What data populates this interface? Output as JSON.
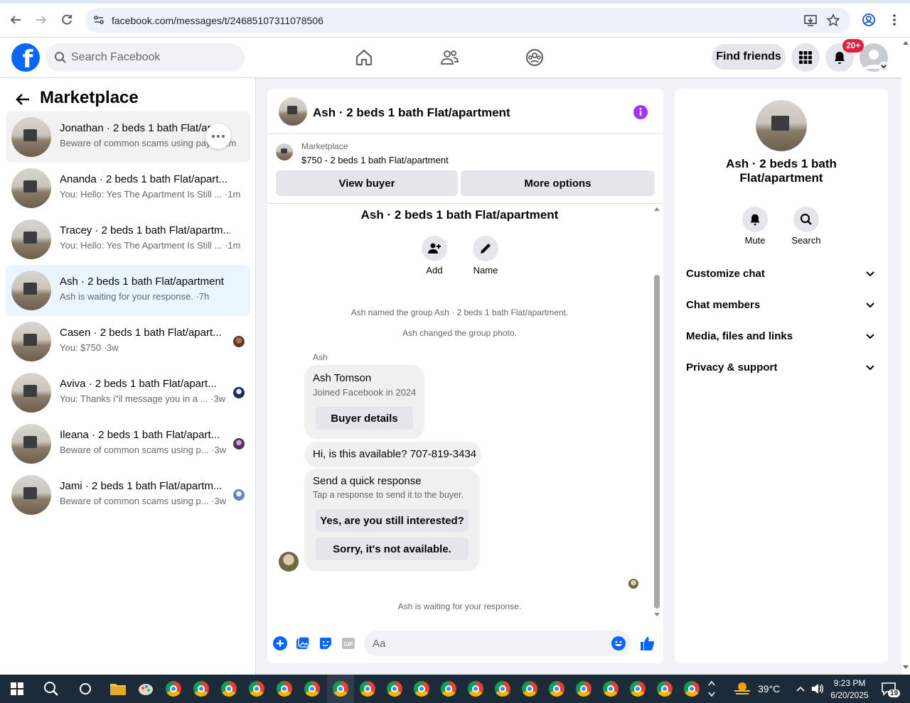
{
  "browser": {
    "url": "facebook.com/messages/t/24685107311078506"
  },
  "header": {
    "search_placeholder": "Search Facebook",
    "find_friends": "Find friends",
    "notifications_badge": "20+"
  },
  "sidebar": {
    "title": "Marketplace",
    "conversations": [
      {
        "title": "Jonathan · 2 beds 1 bath Flat/ap...",
        "subtitle": "Beware of common scams using pay... ·1m",
        "state": "hover"
      },
      {
        "title": "Ananda · 2 beds 1 bath Flat/apart...",
        "subtitle": "You: Hello: Yes The Apartment Is Still ... ·1m",
        "state": "normal"
      },
      {
        "title": "Tracey · 2 beds 1 bath Flat/apartm...",
        "subtitle": "You: Hello: Yes The Apartment Is Still ... ·1m",
        "state": "normal"
      },
      {
        "title": "Ash · 2 beds 1 bath Flat/apartment",
        "subtitle": "Ash is waiting for your response. ·7h",
        "state": "active"
      },
      {
        "title": "Casen · 2 beds 1 bath Flat/apart...",
        "subtitle": "You: $750 ·3w",
        "state": "normal"
      },
      {
        "title": "Aviva · 2 beds 1 bath Flat/apart...",
        "subtitle": "You: Thanks i\"il message you in a ... ·3w",
        "state": "normal"
      },
      {
        "title": "Ileana · 2 beds 1 bath Flat/apart...",
        "subtitle": "Beware of common scams using p... ·3w",
        "state": "normal"
      },
      {
        "title": "Jami · 2 beds 1 bath Flat/apartm...",
        "subtitle": "Beware of common scams using p... ·3w",
        "state": "normal"
      }
    ]
  },
  "chat": {
    "title": "Ash · 2 beds 1 bath Flat/apartment",
    "listing_source": "Marketplace",
    "listing_price_title": "$750 - 2 beds 1 bath Flat/apartment",
    "view_buyer": "View buyer",
    "more_options": "More options",
    "center_title": "Ash · 2 beds 1 bath Flat/apartment",
    "add_label": "Add",
    "name_label": "Name",
    "sys_named": "Ash named the group Ash · 2 beds 1 bath Flat/apartment.",
    "sys_photo": "Ash changed the group photo.",
    "sender": "Ash",
    "card_name": "Ash Tomson",
    "card_joined": "Joined Facebook in 2024",
    "buyer_details": "Buyer details",
    "message": "Hi, is this available? 707-819-3434",
    "quick_title": "Send a quick response",
    "quick_sub": "Tap a response to send it to the buyer.",
    "quick_1": "Yes, are you still interested?",
    "quick_2": "Sorry, it's not available.",
    "waiting": "Ash is waiting for your response.",
    "composer_placeholder": "Aa"
  },
  "right_panel": {
    "name": "Ash · 2 beds 1 bath Flat/apartment",
    "mute": "Mute",
    "search": "Search",
    "rows": [
      "Customize chat",
      "Chat members",
      "Media, files and links",
      "Privacy & support"
    ]
  },
  "taskbar": {
    "weather": "39°C",
    "time": "9:23 PM",
    "date": "6/20/2025",
    "notif_count": "19"
  },
  "colors": {
    "fb_blue": "#0866ff",
    "active_conv": "#ebf5ff",
    "badge_red": "#e41e3f",
    "info_purple": "#a033ff"
  }
}
